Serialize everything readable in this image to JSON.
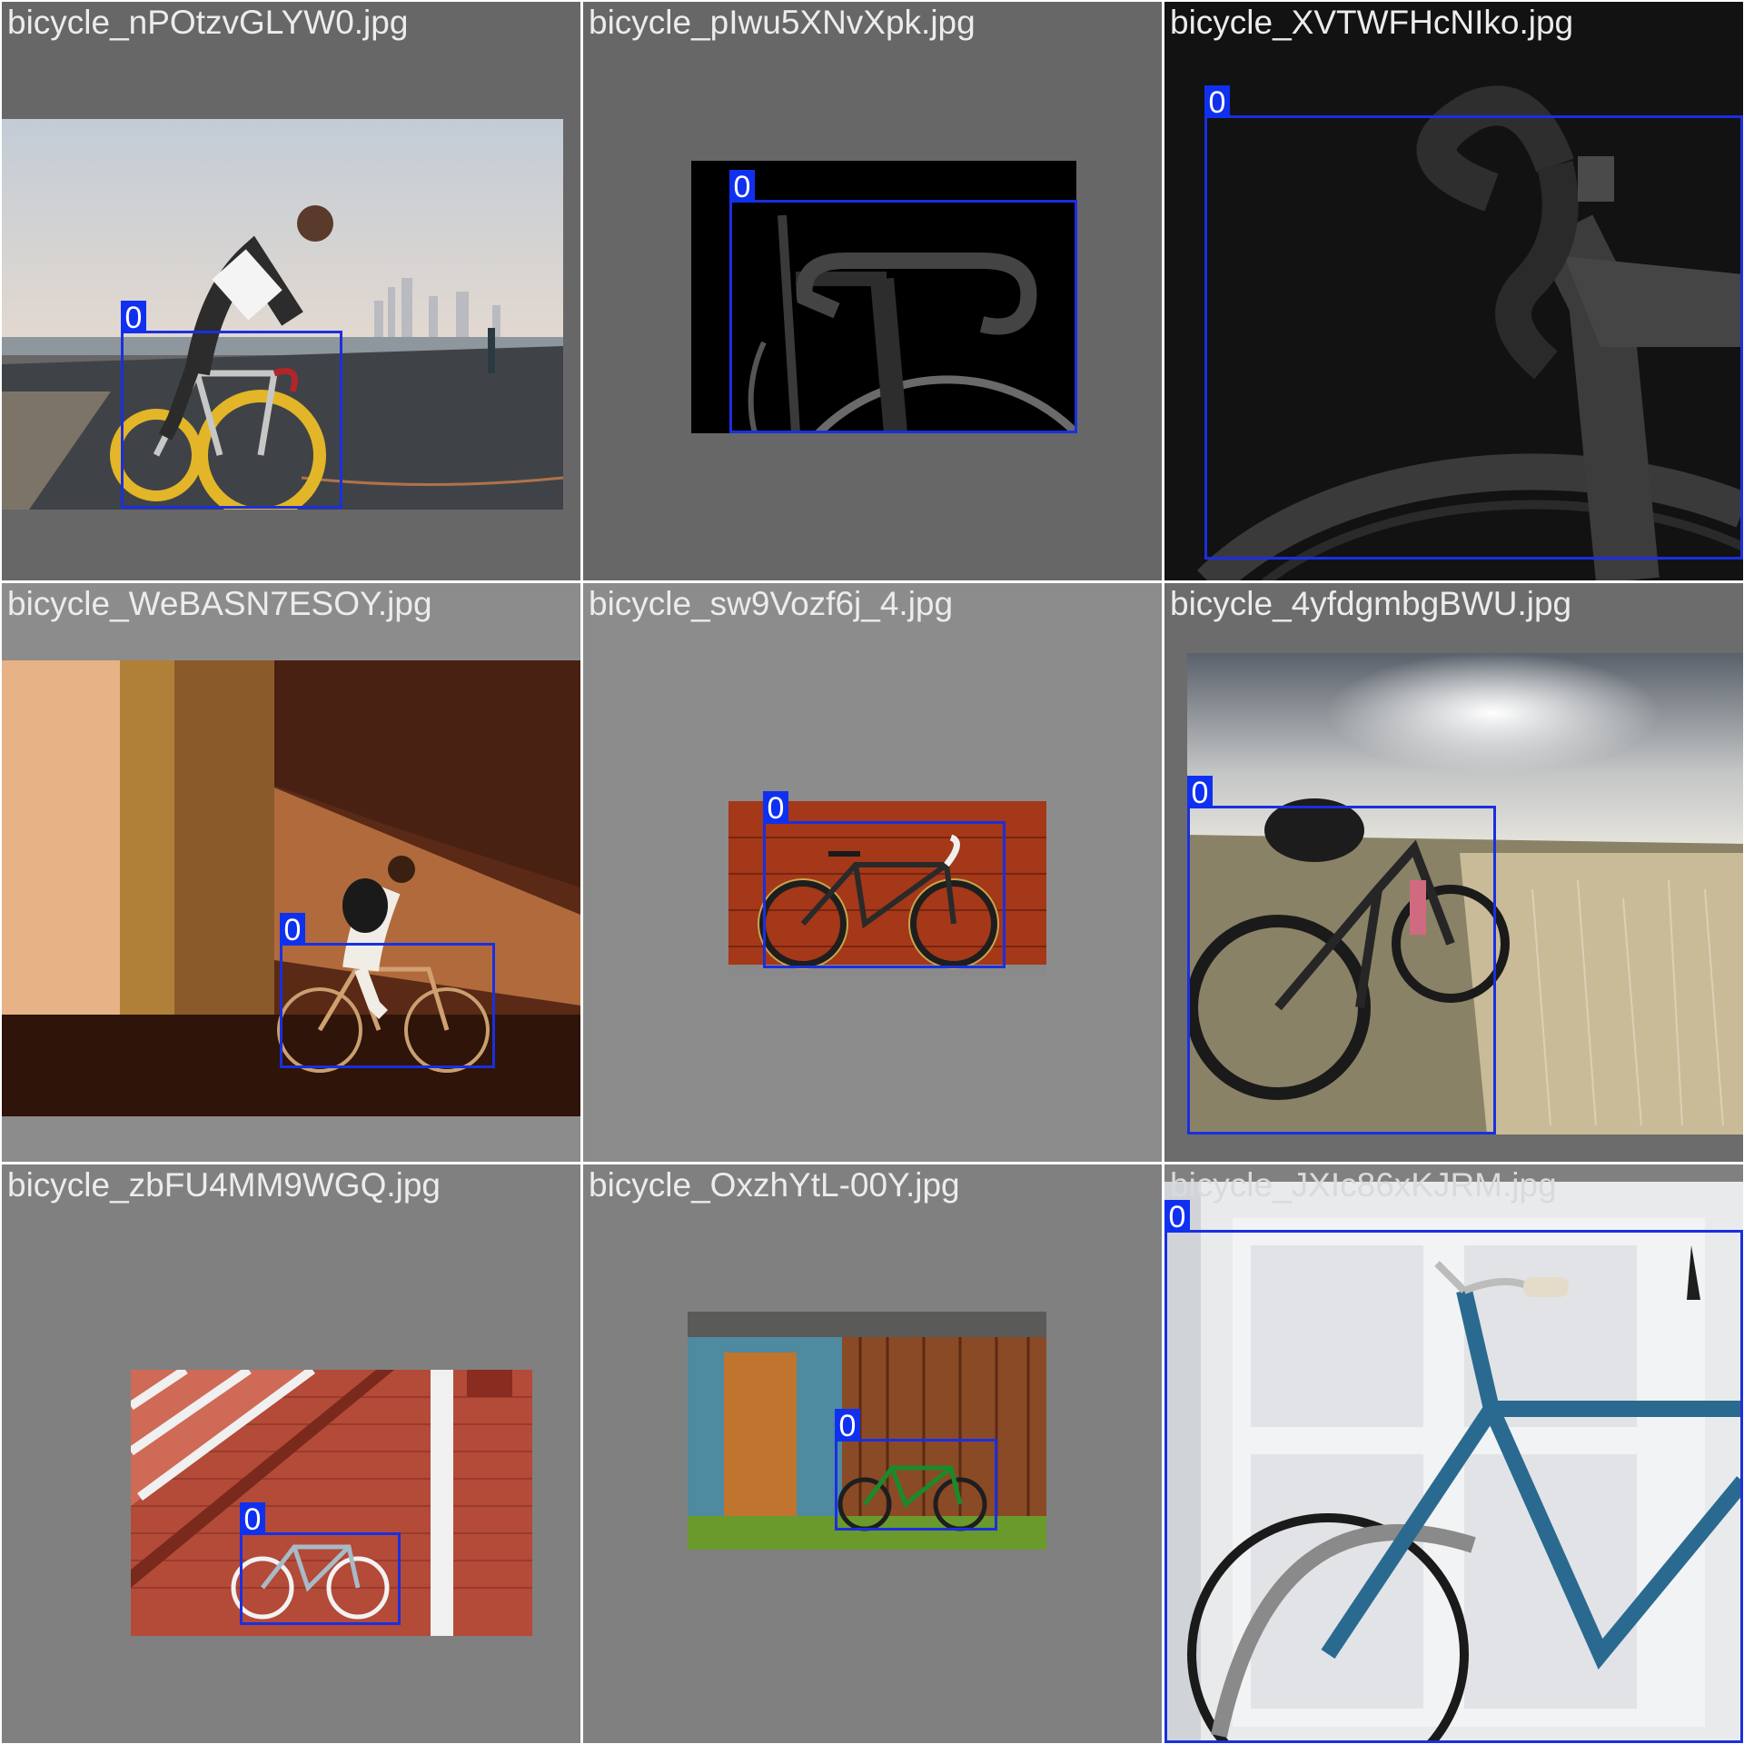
{
  "class_label": "0",
  "colors": {
    "box": "#1a2fe0",
    "label_bg": "#1030f0"
  },
  "tiles": [
    {
      "filename": "bicycle_nPOtzvGLYW0.jpg"
    },
    {
      "filename": "bicycle_pIwu5XNvXpk.jpg"
    },
    {
      "filename": "bicycle_XVTWFHcNIko.jpg"
    },
    {
      "filename": "bicycle_WeBASN7ESOY.jpg"
    },
    {
      "filename": "bicycle_sw9Vozf6j_4.jpg"
    },
    {
      "filename": "bicycle_4yfdgmbgBWU.jpg"
    },
    {
      "filename": "bicycle_zbFU4MM9WGQ.jpg"
    },
    {
      "filename": "bicycle_OxzhYtL-00Y.jpg"
    },
    {
      "filename": "bicycle_JXIc86xKJRM.jpg"
    }
  ]
}
